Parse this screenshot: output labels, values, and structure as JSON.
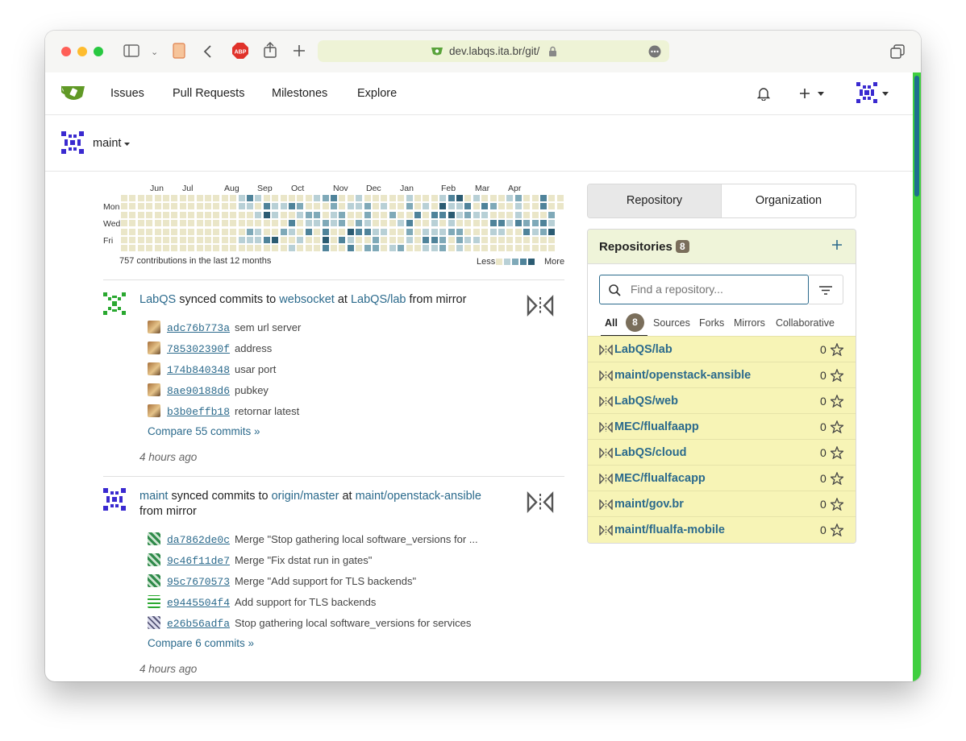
{
  "browser": {
    "url": "dev.labqs.ita.br/git/",
    "buttons": {
      "sidebar": "sidebar-icon",
      "back": "chevron-left-icon",
      "adblock": "ABP",
      "share": "share-icon",
      "new_tab": "plus-icon",
      "tabs": "tabs-icon"
    }
  },
  "nav": {
    "items": [
      "Issues",
      "Pull Requests",
      "Milestones",
      "Explore"
    ]
  },
  "context": {
    "user": "maint"
  },
  "heatmap": {
    "months": [
      "Jun",
      "Jul",
      "Aug",
      "Sep",
      "Oct",
      "Nov",
      "Dec",
      "Jan",
      "Feb",
      "Mar",
      "Apr"
    ],
    "days": [
      "Mon",
      "Wed",
      "Fri"
    ],
    "summary": "757 contributions in the last 12 months",
    "less": "Less",
    "more": "More"
  },
  "feed": [
    {
      "actor": "LabQS",
      "verb": "synced commits to",
      "branch": "websocket",
      "at": "at",
      "repo": "LabQS/lab",
      "suffix": "from mirror",
      "commits": [
        {
          "sha": "adc76b773a",
          "msg": "sem url server"
        },
        {
          "sha": "785302390f",
          "msg": "address"
        },
        {
          "sha": "174b840348",
          "msg": "usar port"
        },
        {
          "sha": "8ae90188d6",
          "msg": "pubkey"
        },
        {
          "sha": "b3b0effb18",
          "msg": "retornar latest"
        }
      ],
      "compare": "Compare 55 commits »",
      "time": "4 hours ago"
    },
    {
      "actor": "maint",
      "verb": "synced commits to",
      "branch": "origin/master",
      "at": "at",
      "repo": "maint/openstack-ansible",
      "suffix": "from mirror",
      "commits": [
        {
          "sha": "da7862de0c",
          "msg": "Merge \"Stop gathering local software_versions for ..."
        },
        {
          "sha": "9c46f11de7",
          "msg": "Merge \"Fix dstat run in gates\""
        },
        {
          "sha": "95c7670573",
          "msg": "Merge \"Add support for TLS backends\""
        },
        {
          "sha": "e9445504f4",
          "msg": "Add support for TLS backends"
        },
        {
          "sha": "e26b56adfa",
          "msg": "Stop gathering local software_versions for services"
        }
      ],
      "compare": "Compare 6 commits »",
      "time": "4 hours ago"
    }
  ],
  "sidebar": {
    "tabs": [
      "Repository",
      "Organization"
    ],
    "title": "Repositories",
    "count": "8",
    "search_placeholder": "Find a repository...",
    "filters": [
      "All",
      "8",
      "Sources",
      "Forks",
      "Mirrors",
      "Collaborative"
    ],
    "repos": [
      {
        "name": "LabQS/lab",
        "stars": "0"
      },
      {
        "name": "maint/openstack-ansible",
        "stars": "0"
      },
      {
        "name": "LabQS/web",
        "stars": "0"
      },
      {
        "name": "MEC/flualfaapp",
        "stars": "0"
      },
      {
        "name": "LabQS/cloud",
        "stars": "0"
      },
      {
        "name": "MEC/flualfacapp",
        "stars": "0"
      },
      {
        "name": "maint/gov.br",
        "stars": "0"
      },
      {
        "name": "maint/flualfa-mobile",
        "stars": "0"
      }
    ]
  },
  "colors": {
    "accent": "#2b6a8c",
    "heat_levels": [
      "#eae6c8",
      "#b8d0d6",
      "#7fa9b8",
      "#4f839a",
      "#2b5b72"
    ],
    "mirror_highlight": "#f7f4b6"
  }
}
